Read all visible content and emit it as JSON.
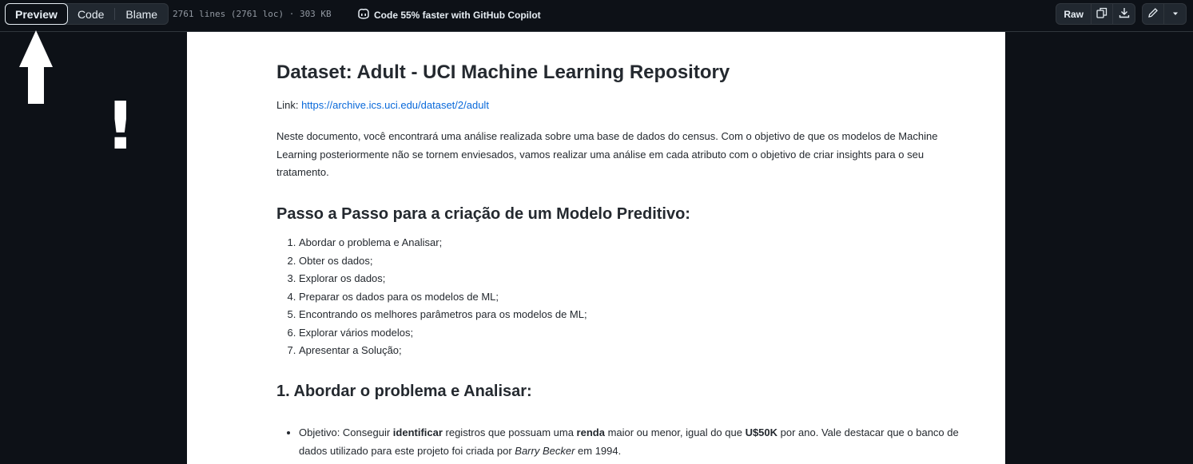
{
  "toolbar": {
    "tabs": [
      {
        "label": "Preview",
        "active": true
      },
      {
        "label": "Code",
        "active": false
      },
      {
        "label": "Blame",
        "active": false
      }
    ],
    "meta": "2761 lines (2761 loc) · 303 KB",
    "copilot_text": "Code 55% faster with GitHub Copilot",
    "raw_label": "Raw",
    "icons": [
      "copy-icon",
      "download-icon",
      "pencil-icon",
      "triangle-down-icon"
    ]
  },
  "annotations": {
    "arrow": "white-up-arrow",
    "exclamation": "!"
  },
  "document": {
    "title": "Dataset: Adult - UCI Machine Learning Repository",
    "link_label": "Link: ",
    "link_url": "https://archive.ics.uci.edu/dataset/2/adult",
    "intro": "Neste documento, você encontrará uma análise realizada sobre uma base de dados do census. Com o objetivo de que os modelos de Machine Learning posteriormente não se tornem enviesados, vamos realizar uma análise em cada atributo com o objetivo de criar insights para o seu tratamento.",
    "steps_heading": "Passo a Passo para a criação de um Modelo Preditivo:",
    "steps": [
      "Abordar o problema e Analisar;",
      "Obter os dados;",
      "Explorar os dados;",
      "Preparar os dados para os modelos de ML;",
      "Encontrando os melhores parâmetros para os modelos de ML;",
      "Explorar vários modelos;",
      "Apresentar a Solução;"
    ],
    "section1_heading": "1. Abordar o problema e Analisar:",
    "objective": {
      "t1": "Objetivo: Conseguir ",
      "b1": "identificar",
      "t2": " registros que possuam uma ",
      "b2": "renda",
      "t3": " maior ou menor, igual do que ",
      "b3": "U$50K",
      "t4": " por ano. Vale destacar que o banco de dados utilizado para este projeto foi criada por ",
      "i1": "Barry Becker",
      "t5": " em 1994."
    }
  }
}
